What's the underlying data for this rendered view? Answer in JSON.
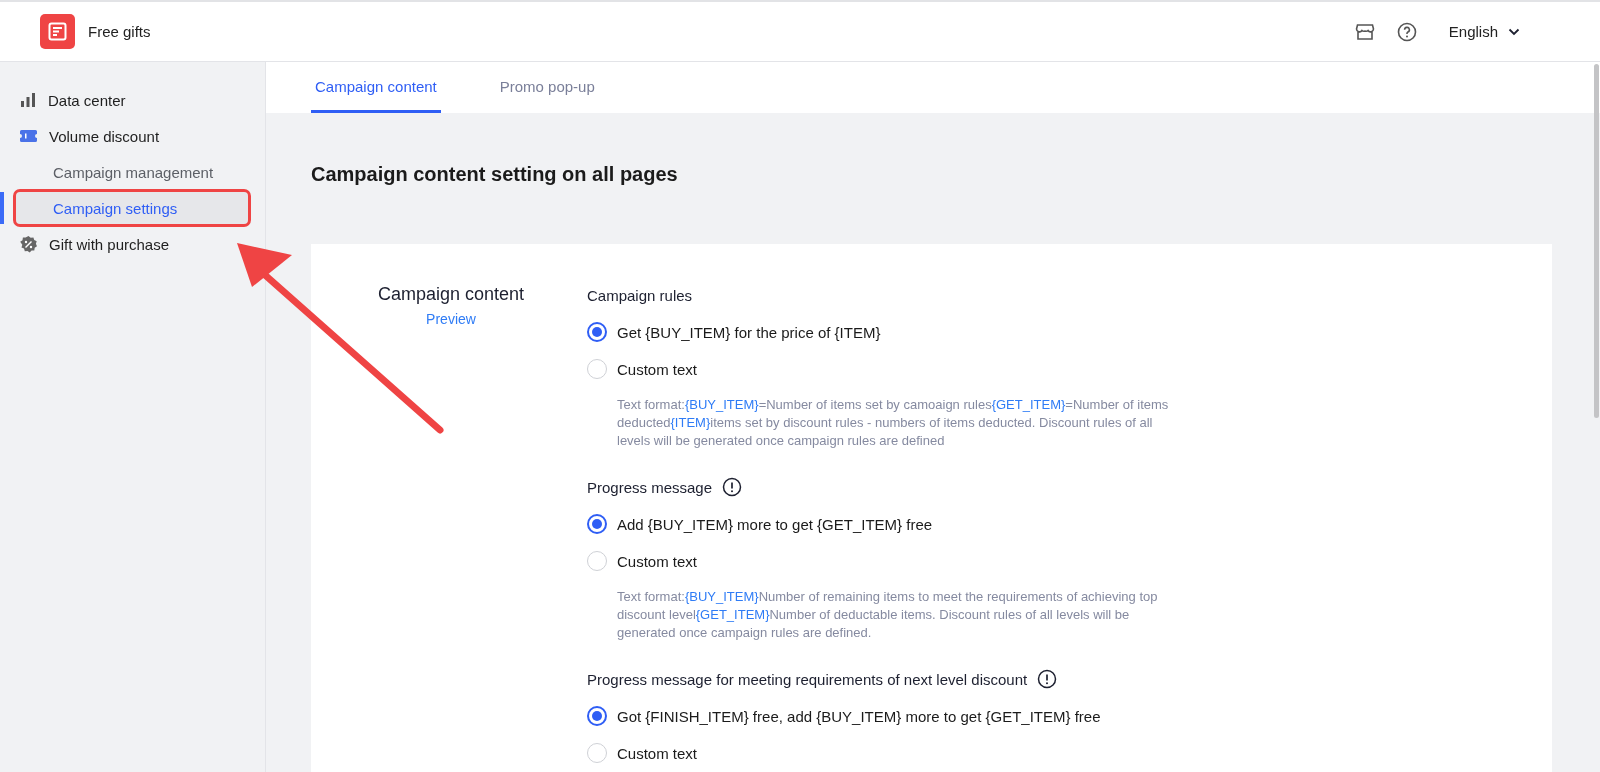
{
  "app": {
    "title": "Free gifts"
  },
  "header": {
    "language": "English"
  },
  "sidebar": {
    "items": [
      {
        "label": "Data center",
        "selected": false
      },
      {
        "label": "Volume discount",
        "selected": false,
        "children": [
          {
            "label": "Campaign management",
            "selected": false,
            "highlighted": false
          },
          {
            "label": "Campaign settings",
            "selected": true,
            "highlighted": true
          }
        ]
      },
      {
        "label": "Gift with purchase",
        "selected": false
      }
    ]
  },
  "tabs": [
    {
      "label": "Campaign content",
      "selected": true
    },
    {
      "label": "Promo pop-up",
      "selected": false
    }
  ],
  "page_title": "Campaign content setting on all pages",
  "card": {
    "label": "Campaign content",
    "link": "Preview",
    "sections": [
      {
        "title": "Campaign rules",
        "info": false,
        "options": [
          {
            "label": "Get {BUY_ITEM} for the price of {ITEM}",
            "selected": true
          },
          {
            "label": "Custom text",
            "selected": false
          }
        ],
        "hint": [
          {
            "kind": "plain",
            "text": "Text format:"
          },
          {
            "kind": "token",
            "text": "{BUY_ITEM}"
          },
          {
            "kind": "plain",
            "text": "=Number of items set by camoaign rules"
          },
          {
            "kind": "token",
            "text": "{GET_ITEM}"
          },
          {
            "kind": "plain",
            "text": "=Number of items deducted"
          },
          {
            "kind": "token",
            "text": "{ITEM}"
          },
          {
            "kind": "plain",
            "text": "items set by discount rules - numbers of items deducted. Discount rules of all levels will be generated once campaign rules are defined"
          }
        ]
      },
      {
        "title": "Progress message",
        "info": true,
        "options": [
          {
            "label": "Add {BUY_ITEM} more to get {GET_ITEM} free",
            "selected": true
          },
          {
            "label": "Custom text",
            "selected": false
          }
        ],
        "hint": [
          {
            "kind": "plain",
            "text": "Text format:"
          },
          {
            "kind": "token",
            "text": "{BUY_ITEM}"
          },
          {
            "kind": "plain",
            "text": "Number of remaining items to meet the requirements of achieving top discount level"
          },
          {
            "kind": "token",
            "text": "{GET_ITEM}"
          },
          {
            "kind": "plain",
            "text": "Number of deductable items. Discount rules of all levels will be generated once campaign rules are defined."
          }
        ]
      },
      {
        "title": "Progress message for meeting requirements of next level discount",
        "info": true,
        "options": [
          {
            "label": "Got {FINISH_ITEM} free, add {BUY_ITEM} more to get {GET_ITEM} free",
            "selected": true
          },
          {
            "label": "Custom text",
            "selected": false
          }
        ]
      }
    ]
  }
}
